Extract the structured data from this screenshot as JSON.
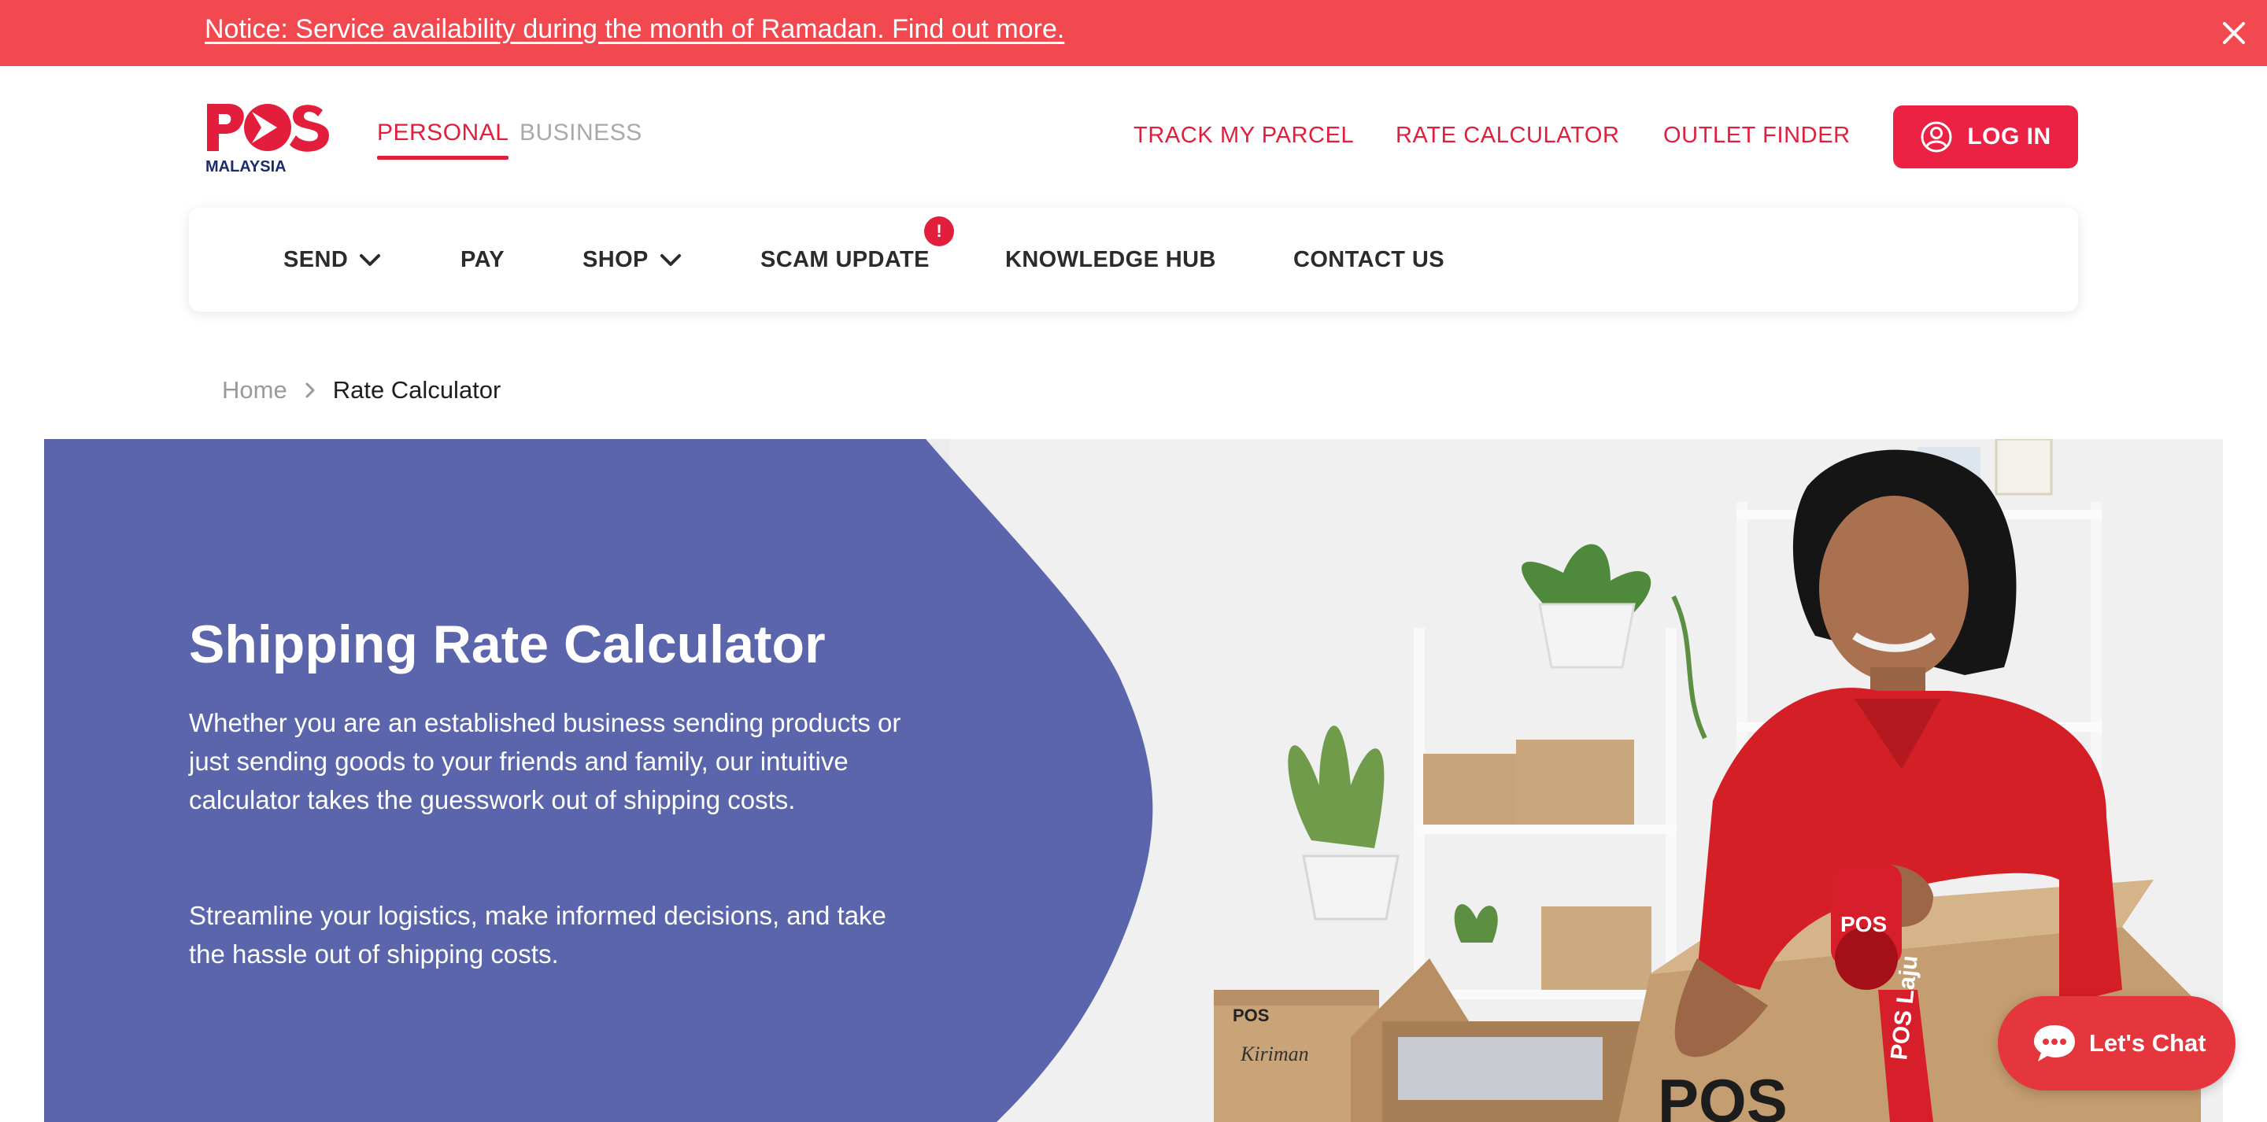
{
  "colors": {
    "brand_red": "#e21e3c",
    "notice_bg": "#f24850",
    "hero_blue": "#5a65ab",
    "chat_bg": "#e4363c"
  },
  "notice": {
    "text": "Notice: Service availability during the month of Ramadan. Find out more.",
    "close_icon": "close-icon"
  },
  "header": {
    "logo": {
      "mark": "POS",
      "sub": "MALAYSIA"
    },
    "segments": [
      {
        "label": "PERSONAL",
        "active": true
      },
      {
        "label": "BUSINESS",
        "active": false
      }
    ],
    "links": [
      {
        "label": "TRACK MY PARCEL"
      },
      {
        "label": "RATE CALCULATOR"
      },
      {
        "label": "OUTLET FINDER"
      }
    ],
    "login": {
      "label": "LOG IN",
      "icon": "user-icon"
    }
  },
  "nav": {
    "items": [
      {
        "label": "SEND",
        "dropdown": true
      },
      {
        "label": "PAY",
        "dropdown": false
      },
      {
        "label": "SHOP",
        "dropdown": true
      },
      {
        "label": "SCAM UPDATE",
        "badge": "!"
      },
      {
        "label": "KNOWLEDGE HUB"
      },
      {
        "label": "CONTACT US"
      }
    ]
  },
  "breadcrumb": {
    "home": "Home",
    "current": "Rate Calculator"
  },
  "hero": {
    "title": "Shipping Rate Calculator",
    "paragraphs": [
      "Whether you are an established business sending products or just sending goods to your friends and family, our intuitive calculator takes the guesswork out of shipping costs.",
      "Streamline your logistics, make informed decisions, and take the hassle out of shipping costs."
    ],
    "image_alt": "Pos Malaysia staff sealing a parcel box with branded tape",
    "box_print": "POS",
    "box_print_sub": "Kiriman",
    "tape_print": "POS Laju"
  },
  "chat": {
    "label": "Let's Chat",
    "icon": "chat-bubble-icon"
  }
}
